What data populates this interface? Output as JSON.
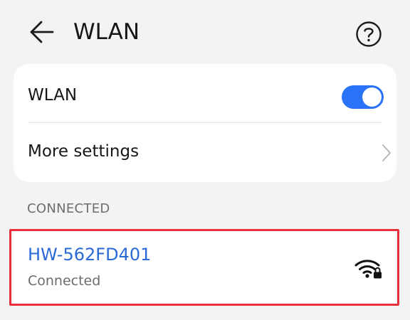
{
  "header": {
    "title": "WLAN",
    "back_icon": "arrow-left-icon",
    "help_icon": "help-circle-icon"
  },
  "wlan_card": {
    "toggle_label": "WLAN",
    "toggle_on": true,
    "more_settings_label": "More settings"
  },
  "connected_section": {
    "header": "CONNECTED"
  },
  "network": {
    "ssid": "HW-562FD401",
    "status": "Connected",
    "signal_icon": "wifi-locked-icon"
  },
  "colors": {
    "accent": "#2a72f6",
    "ssid": "#2a6ad8",
    "highlight": "#e8303a",
    "background": "#f1f3f5"
  }
}
